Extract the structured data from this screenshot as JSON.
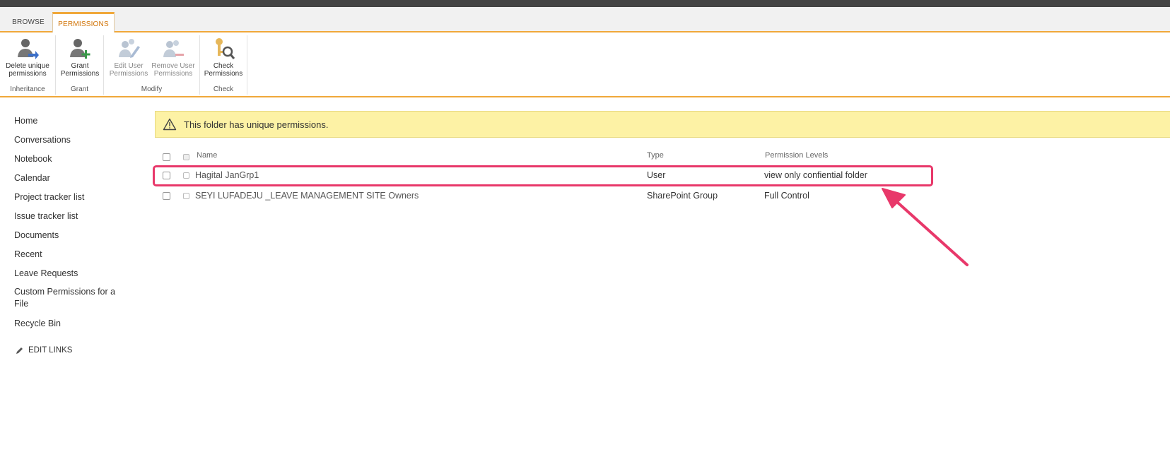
{
  "tabs": {
    "browse": "BROWSE",
    "permissions": "PERMISSIONS"
  },
  "ribbon": {
    "groups": [
      {
        "label": "Inheritance",
        "buttons": [
          {
            "line1": "Delete unique",
            "line2": "permissions"
          }
        ]
      },
      {
        "label": "Grant",
        "buttons": [
          {
            "line1": "Grant",
            "line2": "Permissions"
          }
        ]
      },
      {
        "label": "Modify",
        "buttons": [
          {
            "line1": "Edit User",
            "line2": "Permissions"
          },
          {
            "line1": "Remove User",
            "line2": "Permissions"
          }
        ]
      },
      {
        "label": "Check",
        "buttons": [
          {
            "line1": "Check",
            "line2": "Permissions"
          }
        ]
      }
    ]
  },
  "nav": {
    "items": [
      "Home",
      "Conversations",
      "Notebook",
      "Calendar",
      "Project tracker list",
      "Issue tracker list",
      "Documents",
      "Recent",
      "Leave Requests",
      "Custom Permissions for a File",
      "Recycle Bin"
    ],
    "edit_links": "EDIT LINKS"
  },
  "banner": {
    "message": "This folder has unique permissions."
  },
  "table": {
    "headers": {
      "name": "Name",
      "type": "Type",
      "level": "Permission Levels"
    },
    "rows": [
      {
        "name": "Hagital JanGrp1",
        "type": "User",
        "level": "view only confiential folder"
      },
      {
        "name": "SEYI LUFADEJU _LEAVE MANAGEMENT SITE Owners",
        "type": "SharePoint Group",
        "level": "Full Control"
      }
    ]
  },
  "colors": {
    "accent": "#f0a83a",
    "highlight": "#e8386a",
    "banner": "#fdf2a5"
  }
}
